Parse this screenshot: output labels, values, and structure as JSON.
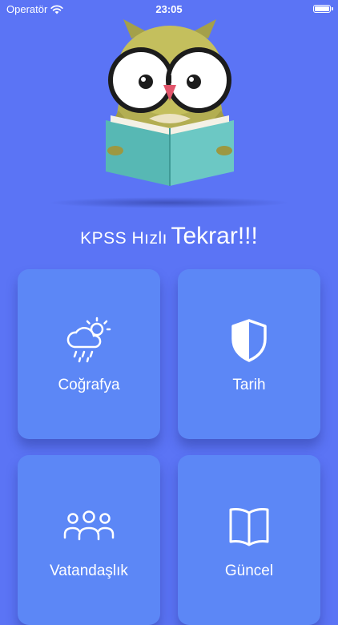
{
  "status_bar": {
    "carrier": "Operatör",
    "time": "23:05",
    "icons": [
      "wifi-icon",
      "battery-icon"
    ]
  },
  "hero": {
    "image": "owl-reading-book-illustration"
  },
  "title": {
    "prefix": "KPSS Hızlı",
    "emphasis": "Tekrar!!!"
  },
  "categories": [
    {
      "label": "Coğrafya",
      "icon": "weather-icon"
    },
    {
      "label": "Tarih",
      "icon": "shield-icon"
    },
    {
      "label": "Vatandaşlık",
      "icon": "people-icon"
    },
    {
      "label": "Güncel",
      "icon": "book-icon"
    }
  ],
  "colors": {
    "background": "#5b74f5",
    "card": "#5c87f6",
    "text": "#ffffff"
  }
}
